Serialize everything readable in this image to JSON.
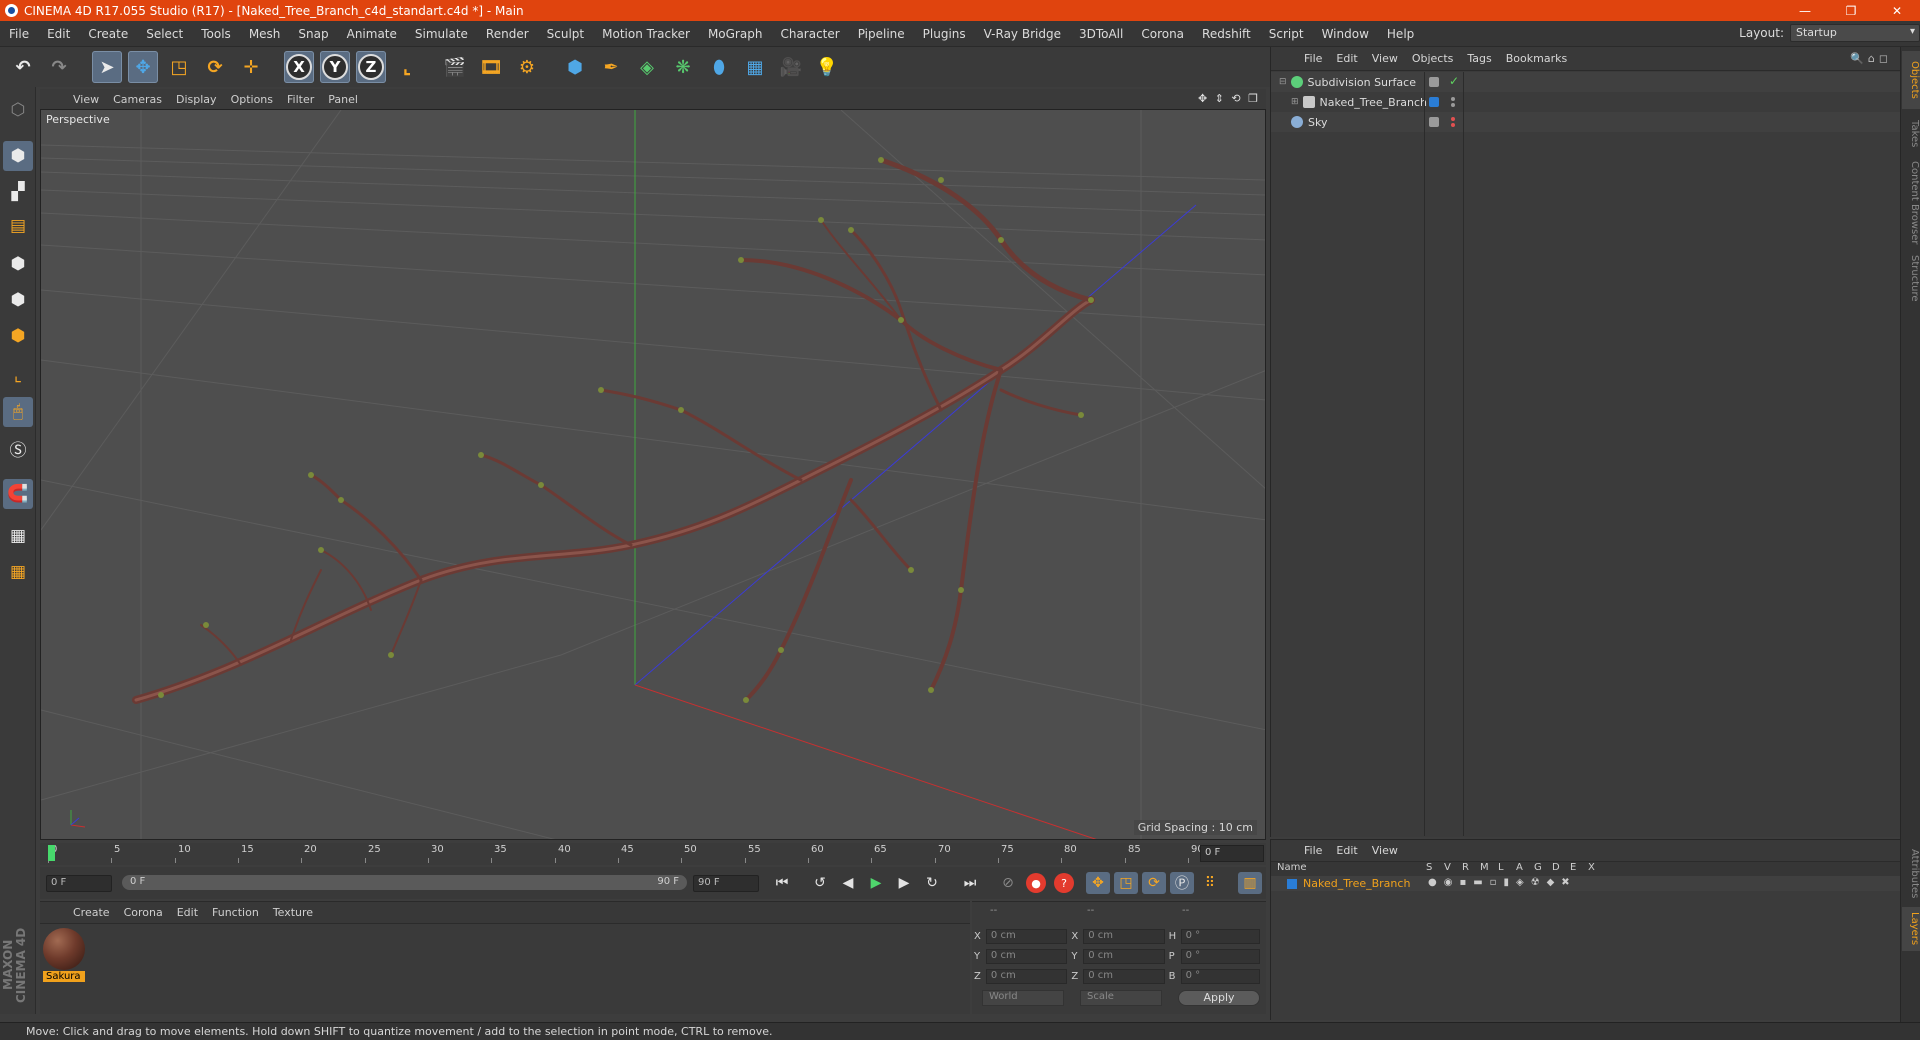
{
  "window": {
    "title": "CINEMA 4D R17.055 Studio (R17) - [Naked_Tree_Branch_c4d_standart.c4d *] - Main",
    "controls": [
      "—",
      "❐",
      "✕"
    ]
  },
  "menubar": {
    "items": [
      "File",
      "Edit",
      "Create",
      "Select",
      "Tools",
      "Mesh",
      "Snap",
      "Animate",
      "Simulate",
      "Render",
      "Sculpt",
      "Motion Tracker",
      "MoGraph",
      "Character",
      "Pipeline",
      "Plugins",
      "V-Ray Bridge",
      "3DToAll",
      "Corona",
      "Redshift",
      "Script",
      "Window",
      "Help"
    ],
    "layout_label": "Layout:",
    "layout_value": "Startup"
  },
  "toolbar": {
    "icons": [
      "undo-icon",
      "redo-icon",
      "select-arrow-icon",
      "move-icon",
      "scale-icon",
      "rotate-icon",
      "move-plus-icon",
      "x-axis-icon",
      "y-axis-icon",
      "z-axis-icon",
      "coordinate-system-icon",
      "render-view-icon",
      "render-picture-viewer-icon",
      "render-settings-icon",
      "cube-icon",
      "pen-spline-icon",
      "subdivision-nurbs-icon",
      "array-icon",
      "deformer-icon",
      "floor-icon",
      "camera-icon",
      "light-icon"
    ],
    "axis_labels": [
      "X",
      "Y",
      "Z"
    ]
  },
  "viewport": {
    "menu": [
      "View",
      "Cameras",
      "Display",
      "Options",
      "Filter",
      "Panel"
    ],
    "label": "Perspective",
    "grid_spacing": "Grid Spacing : 10 cm",
    "nav_icons": "✥ ⇕ ⟲ ❐"
  },
  "timeline": {
    "ticks": [
      "0",
      "5",
      "10",
      "15",
      "20",
      "25",
      "30",
      "35",
      "40",
      "45",
      "50",
      "55",
      "60",
      "65",
      "70",
      "75",
      "80",
      "85",
      "90"
    ],
    "end_field": "0 F"
  },
  "transport": {
    "start_field": "0 F",
    "scrub_left": "0 F",
    "scrub_right": "90 F",
    "end_field": "90 F"
  },
  "material_manager": {
    "menu": [
      "Create",
      "Corona",
      "Edit",
      "Function",
      "Texture"
    ],
    "materials": [
      {
        "name": "Sakura"
      }
    ]
  },
  "coordinates": {
    "headers": [
      "--",
      "--",
      "--"
    ],
    "rows": [
      {
        "a": "X",
        "av": "0 cm",
        "b": "X",
        "bv": "0 cm",
        "c": "H",
        "cv": "0 °"
      },
      {
        "a": "Y",
        "av": "0 cm",
        "b": "Y",
        "bv": "0 cm",
        "c": "P",
        "cv": "0 °"
      },
      {
        "a": "Z",
        "av": "0 cm",
        "b": "Z",
        "bv": "0 cm",
        "c": "B",
        "cv": "0 °"
      }
    ],
    "mode": "World",
    "type": "Scale",
    "apply": "Apply"
  },
  "object_manager": {
    "menu": [
      "File",
      "Edit",
      "View",
      "Objects",
      "Tags",
      "Bookmarks"
    ],
    "objects": [
      {
        "name": "Subdivision Surface",
        "icon_color": "#5ccf7a"
      },
      {
        "name": "Naked_Tree_Branch",
        "icon_color": "#c8c8c8"
      },
      {
        "name": "Sky",
        "icon_color": "#8aaed6"
      }
    ]
  },
  "right_tabs": [
    "Objects",
    "Takes",
    "Content Browser",
    "Structure",
    "Attributes",
    "Layers"
  ],
  "layer_manager": {
    "menu": [
      "File",
      "Edit",
      "View"
    ],
    "columns": [
      "Name",
      "S",
      "V",
      "R",
      "M",
      "L",
      "A",
      "G",
      "D",
      "E",
      "X"
    ],
    "layers": [
      {
        "name": "Naked_Tree_Branch",
        "color": "#2a7dd6"
      }
    ]
  },
  "status": {
    "text": "Move: Click and drag to move elements. Hold down SHIFT to quantize movement / add to the selection in point mode, CTRL to remove."
  },
  "branding": {
    "text": "MAXON CINEMA 4D"
  }
}
